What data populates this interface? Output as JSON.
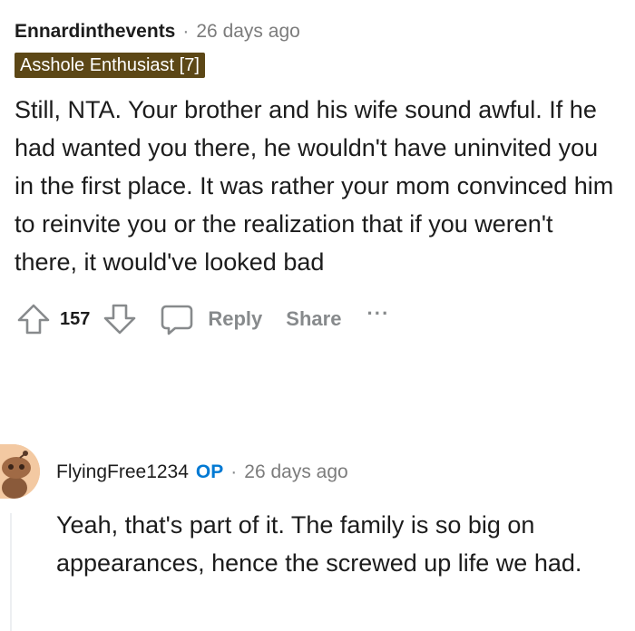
{
  "comment1": {
    "author": "Ennardinthevents",
    "separator": "·",
    "time": "26 days ago",
    "flair": "Asshole Enthusiast [7]",
    "body": "Still, NTA. Your brother and his wife sound awful. If he had wanted you there, he wouldn't have uninvited you in the first place. It was rather your mom convinced him to reinvite you or the realization that if you weren't there, it would've looked bad",
    "score": "157",
    "reply_label": "Reply",
    "share_label": "Share",
    "more_label": "···"
  },
  "comment2": {
    "author": "FlyingFree1234",
    "op_badge": "OP",
    "separator": "·",
    "time": "26 days ago",
    "body": "Yeah, that's part of it. The family is so big on appearances, hence the screwed up life we had."
  },
  "colors": {
    "flair_bg": "#5c4716",
    "op": "#0079d3",
    "muted": "#878a8c"
  },
  "icons": [
    "upvote-icon",
    "downvote-icon",
    "comment-bubble-icon",
    "more-icon",
    "snoo-avatar-icon"
  ]
}
